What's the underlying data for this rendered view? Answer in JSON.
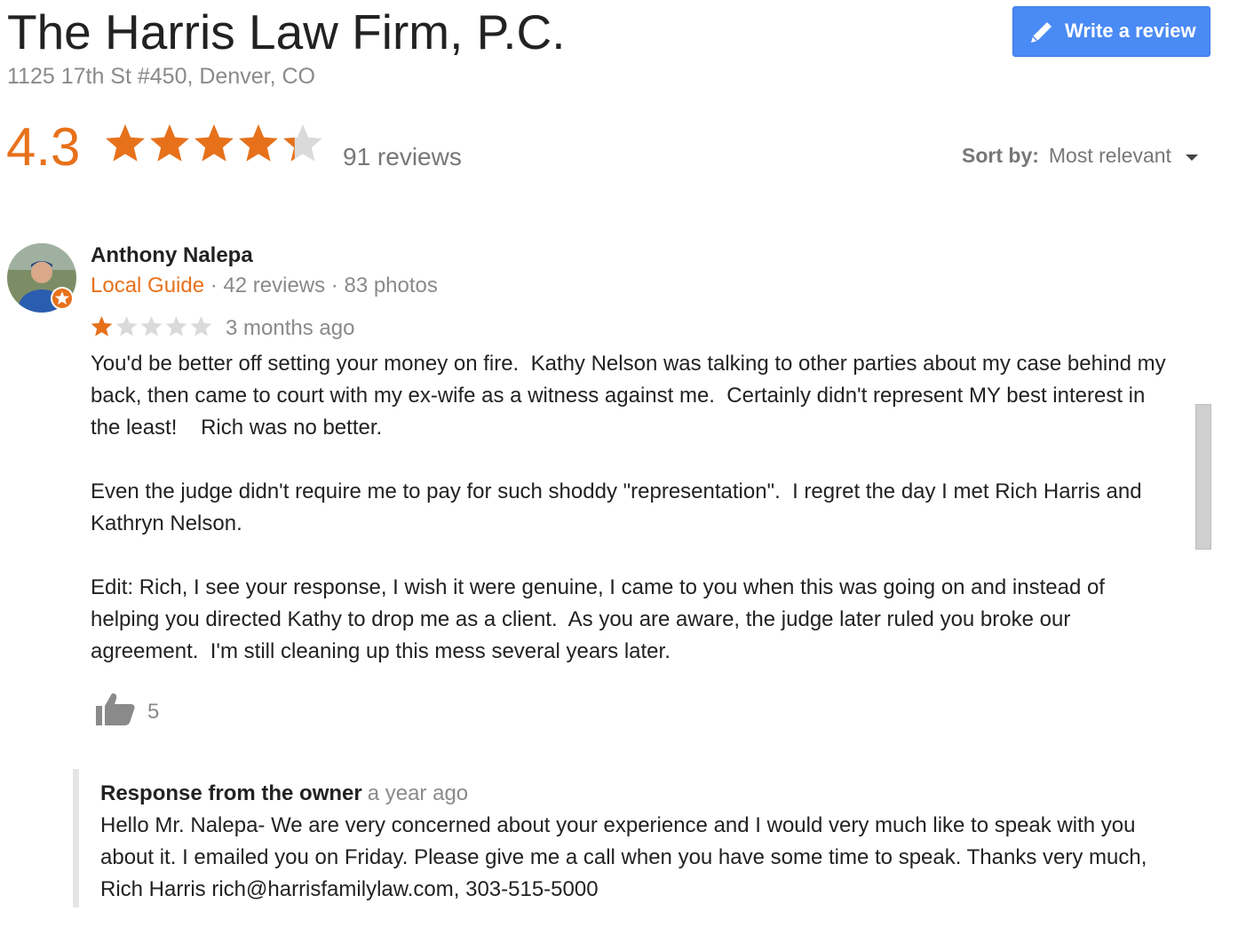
{
  "business": {
    "name": "The Harris Law Firm, P.C.",
    "address": "1125 17th St #450, Denver, CO"
  },
  "actions": {
    "write_review_label": "Write a review",
    "write_review_icon": "pencil-icon"
  },
  "summary": {
    "rating": "4.3",
    "rating_value": 4.3,
    "stars_max": 5,
    "review_count": "91 reviews",
    "star_color": "#e7711b"
  },
  "sort": {
    "label": "Sort by:",
    "value": "Most relevant"
  },
  "review": {
    "author": "Anthony Nalepa",
    "badge": "Local Guide",
    "stats": " · 42 reviews · 83 photos",
    "rating_value": 1,
    "date": "3 months ago",
    "paragraphs": [
      "You'd be better off setting your money on fire.  Kathy Nelson was talking to other parties about my case behind my back, then came to court with my ex-wife as a witness against me.  Certainly didn't represent MY best interest in the least!    Rich was no better.",
      "Even the judge didn't require me to pay for such shoddy \"representation\".  I regret the day I met Rich Harris and Kathryn Nelson.",
      "Edit: Rich, I see your response, I wish it were genuine, I came to you when this was going on and instead of helping you directed Kathy to drop me as a client.  As you are aware, the judge later ruled you broke our agreement.  I'm still cleaning up this mess several years later."
    ],
    "likes": "5"
  },
  "owner_response": {
    "title": "Response from the owner",
    "date": "a year ago",
    "text": "Hello Mr. Nalepa- We are very concerned about your experience and I would very much like to speak with you about it. I emailed you on Friday. Please give me a call when you have some time to speak. Thanks very much, Rich Harris rich@harrisfamilylaw.com, 303-515-5000"
  },
  "colors": {
    "accent_orange": "#e7711b",
    "button_blue": "#4a8af4",
    "muted_text": "#8a8a8a"
  }
}
